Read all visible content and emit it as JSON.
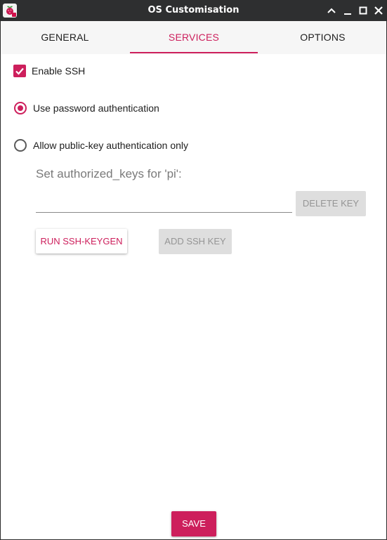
{
  "window": {
    "title": "OS Customisation",
    "app_icon": "raspberry-pi-icon"
  },
  "titlebar_buttons": {
    "shade_icon": "chevron-up-icon",
    "minimize_icon": "minimize-icon",
    "maximize_icon": "maximize-icon",
    "close_icon": "close-icon"
  },
  "tabs": [
    {
      "label": "GENERAL",
      "active": false
    },
    {
      "label": "SERVICES",
      "active": true
    },
    {
      "label": "OPTIONS",
      "active": false
    }
  ],
  "ssh": {
    "enable_label": "Enable SSH",
    "enable_checked": true,
    "password_auth_label": "Use password authentication",
    "password_auth_selected": true,
    "pubkey_auth_label": "Allow public-key authentication only",
    "pubkey_auth_selected": false,
    "authorized_keys_label": "Set authorized_keys for 'pi':",
    "authorized_key_value": ""
  },
  "buttons": {
    "delete_key": "DELETE KEY",
    "run_keygen": "RUN SSH-KEYGEN",
    "add_key": "ADD SSH KEY",
    "save": "SAVE"
  },
  "colors": {
    "accent": "#cd1f5c",
    "titlebar": "#2e2f30",
    "tabbar": "#f6f6f6",
    "disabled_bg": "#dedede",
    "disabled_text": "#959595"
  }
}
